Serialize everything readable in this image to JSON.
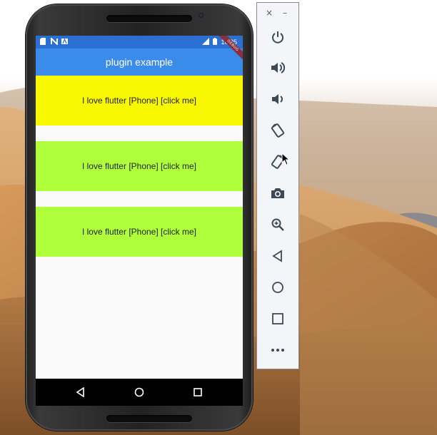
{
  "app": {
    "title": "plugin example",
    "debug_banner": "DEBUG"
  },
  "status_bar": {
    "time": "10:35",
    "left_icons": [
      "sd-card-icon",
      "n-icon",
      "a-icon"
    ],
    "right_icons": [
      "signal-icon",
      "battery-icon"
    ]
  },
  "list": {
    "items": [
      {
        "label": "I love flutter [Phone] [click me]",
        "color": "#f8f800"
      },
      {
        "label": "I love flutter [Phone] [click me]",
        "color": "#b0ff3c"
      },
      {
        "label": "I love flutter [Phone] [click me]",
        "color": "#b0ff3c"
      }
    ]
  },
  "nav": [
    "back",
    "home",
    "overview"
  ],
  "toolbar": {
    "close_label": "×",
    "minimize_label": "–",
    "buttons": [
      "power",
      "volume-up",
      "volume-down",
      "rotate-left",
      "rotate-right",
      "take-screenshot",
      "zoom",
      "back",
      "home",
      "overview",
      "more"
    ]
  },
  "colors": {
    "app_bar": "#3b8beb",
    "status_bar": "#2a6fd1",
    "item_yellow": "#f8f800",
    "item_green": "#b0ff3c"
  }
}
